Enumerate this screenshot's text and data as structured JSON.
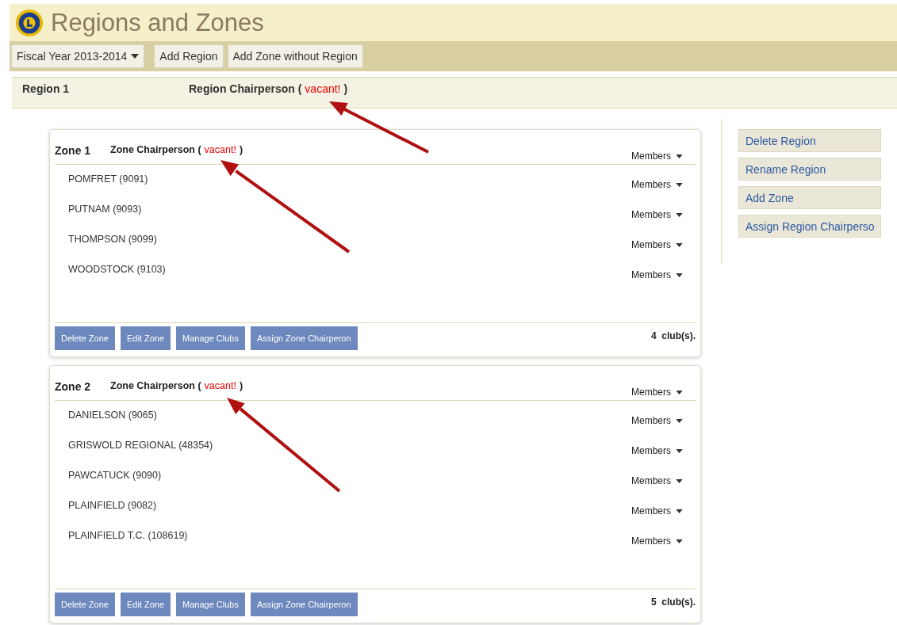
{
  "page": {
    "title": "Regions and Zones"
  },
  "toolbar": {
    "fiscal_year": "Fiscal Year 2013-2014",
    "buttons": [
      "Add Region",
      "Add Zone without Region"
    ]
  },
  "region": {
    "name": "Region 1",
    "chairperson_label": "Region Chairperson (",
    "chairperson_value": "vacant!",
    "chairperson_close": ")"
  },
  "zones": [
    {
      "name": "Zone 1",
      "chairperson_label": "Zone Chairperson (",
      "chairperson_value": "vacant!",
      "chairperson_close": ")",
      "members": "Members",
      "clubs": [
        {
          "name": "POMFRET (9091)",
          "members": "Members"
        },
        {
          "name": "PUTNAM (9093)",
          "members": "Members"
        },
        {
          "name": "THOMPSON (9099)",
          "members": "Members"
        },
        {
          "name": "WOODSTOCK (9103)",
          "members": "Members"
        }
      ],
      "buttons": [
        "Delete Zone",
        "Edit Zone",
        "Manage Clubs",
        "Assign Zone Chairperon"
      ],
      "count": "4  club(s)."
    },
    {
      "name": "Zone 2",
      "chairperson_label": "Zone Chairperson (",
      "chairperson_value": "vacant!",
      "chairperson_close": ")",
      "members": "Members",
      "clubs": [
        {
          "name": "DANIELSON (9065)",
          "members": "Members"
        },
        {
          "name": "GRISWOLD REGIONAL (48354)",
          "members": "Members"
        },
        {
          "name": "PAWCATUCK (9090)",
          "members": "Members"
        },
        {
          "name": "PLAINFIELD (9082)",
          "members": "Members"
        },
        {
          "name": "PLAINFIELD T.C. (108619)",
          "members": "Members"
        }
      ],
      "buttons": [
        "Delete Zone",
        "Edit Zone",
        "Manage Clubs",
        "Assign Zone Chairperon"
      ],
      "count": "5  club(s)."
    }
  ],
  "region_actions": [
    "Delete Region",
    "Rename Region",
    "Add Zone",
    "Assign Region Chairperso"
  ]
}
